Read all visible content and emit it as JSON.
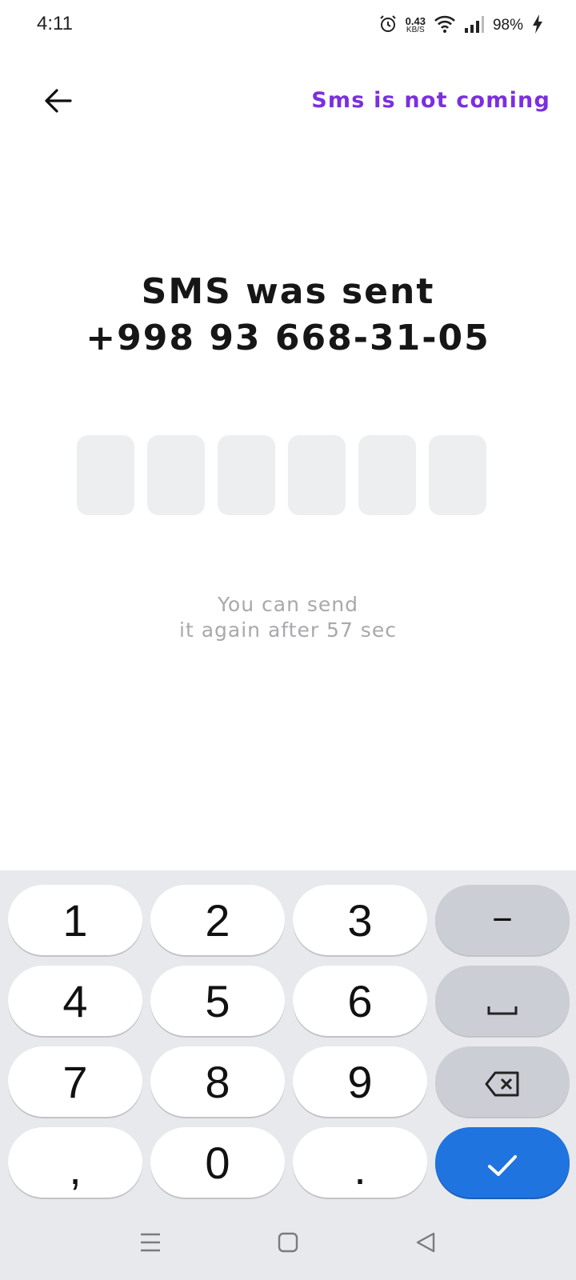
{
  "status_bar": {
    "time": "4:11",
    "net_speed_value": "0.43",
    "net_speed_unit": "KB/S",
    "battery": "98%"
  },
  "header": {
    "back_icon": "arrow-left-icon",
    "sms_not_coming": "Sms is not coming"
  },
  "title": {
    "line1": "SMS was sent",
    "phone": "+998 93 668-31-05"
  },
  "code": {
    "length": 6,
    "digits": [
      "",
      "",
      "",
      "",
      "",
      ""
    ]
  },
  "resend": {
    "line1": "You can send",
    "line2": "it again after 57 sec"
  },
  "keyboard": {
    "k1": "1",
    "k2": "2",
    "k3": "3",
    "k4": "4",
    "k5": "5",
    "k6": "6",
    "k7": "7",
    "k8": "8",
    "k9": "9",
    "comma": ",",
    "k0": "0",
    "dot": ".",
    "minus": "−",
    "accent_color": "#1f74e0"
  },
  "colors": {
    "link": "#7b2fe0",
    "code_box": "#eceef0",
    "hint_text": "#a8a8ad"
  }
}
